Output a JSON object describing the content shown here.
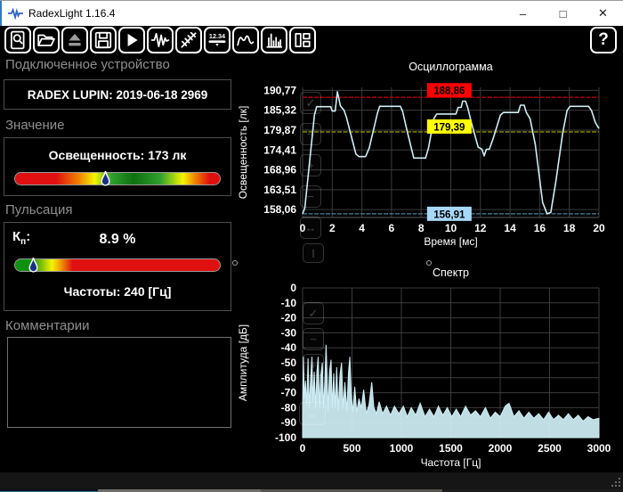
{
  "window": {
    "title": "RadexLight 1.16.4",
    "controls": {
      "minimize": "–",
      "maximize": "□",
      "close": "✕"
    }
  },
  "toolbar": {
    "buttons": [
      {
        "name": "preview",
        "icon": "magnifier"
      },
      {
        "name": "open",
        "icon": "folder"
      },
      {
        "name": "eject",
        "icon": "eject"
      },
      {
        "name": "save",
        "icon": "floppy"
      },
      {
        "name": "start",
        "icon": "play"
      },
      {
        "name": "pulsation-mode",
        "icon": "pulse"
      },
      {
        "name": "light-rays-mode",
        "icon": "rays"
      },
      {
        "name": "numeric-display",
        "icon": "numeric",
        "label": "12.34"
      },
      {
        "name": "oscillogram-view",
        "icon": "wave"
      },
      {
        "name": "spectrum-view",
        "icon": "bars"
      },
      {
        "name": "layout-view",
        "icon": "layout"
      }
    ],
    "help_label": "?"
  },
  "sections": {
    "device": {
      "header": "Подключенное устройство",
      "device_name": "RADEX LUPIN: 2019-06-18 2969"
    },
    "value": {
      "header": "Значение",
      "value_label": "Освещенность: 173 лк",
      "bar_marker": 0.44
    },
    "pulsation": {
      "header": "Пульсация",
      "kp_prefix": "К",
      "kp_sub": "п",
      "kp_suffix": ":",
      "value": "8.9 %",
      "bar_marker": 0.085,
      "freq_label": "Частоты: 240 [Гц]"
    },
    "comments": {
      "header": "Комментарии",
      "text": ""
    }
  },
  "colors": {
    "waveform": "#cfeef5",
    "ref_max_line": "#b40000",
    "ref_max_bg": "#ff0000",
    "ref_avg_line": "#8f8f00",
    "ref_avg_bg": "#ffff00",
    "ref_min_line": "#4e82a0",
    "ref_min_bg": "#a8d8f8",
    "grid": "#3c3c3c"
  },
  "chart_data": [
    {
      "type": "line",
      "title": "Осциллограмма",
      "xlabel": "Время [мс]",
      "ylabel": "Освещенность [лк]",
      "xlim": [
        0,
        20
      ],
      "ylim": [
        155.9,
        191.6
      ],
      "xticks": [
        0,
        2,
        4,
        6,
        8,
        10,
        12,
        14,
        16,
        18,
        20
      ],
      "xtick_labels": [
        "0",
        "2",
        "4",
        "6",
        "8",
        "10",
        "12",
        "14",
        "16",
        "18",
        "20"
      ],
      "yticks": [
        190.77,
        185.32,
        179.87,
        174.41,
        168.96,
        163.51,
        158.06
      ],
      "ytick_labels": [
        "190,77",
        "185,32",
        "179,87",
        "174,41",
        "168,96",
        "163,51",
        "158,06"
      ],
      "grid": true,
      "ref_lines": [
        {
          "value": 188.86,
          "label": "188,86",
          "line_color": "#b40000",
          "label_bg": "#ff0000",
          "label_dy": -16
        },
        {
          "value": 179.39,
          "label": "179,39",
          "line_color": "#8f8f00",
          "label_bg": "#ffff00",
          "label_dy": -14
        },
        {
          "value": 156.91,
          "label": "156,91",
          "line_color": "#4e82a0",
          "label_bg": "#a8d8f8",
          "label_dy": -8
        }
      ],
      "series": [
        {
          "name": "illuminance",
          "color": "#cfeef5",
          "points": [
            [
              0,
              156.9
            ],
            [
              0.15,
              158.5
            ],
            [
              0.8,
              184.0
            ],
            [
              0.95,
              186.3
            ],
            [
              1.9,
              186.3
            ],
            [
              2.0,
              185.1
            ],
            [
              2.2,
              185.1
            ],
            [
              2.35,
              190.4
            ],
            [
              2.55,
              186.5
            ],
            [
              2.8,
              185.3
            ],
            [
              2.95,
              183.5
            ],
            [
              3.6,
              173.3
            ],
            [
              3.8,
              172.6
            ],
            [
              4.25,
              172.6
            ],
            [
              4.5,
              175.0
            ],
            [
              5.05,
              184.5
            ],
            [
              5.2,
              186.4
            ],
            [
              6.6,
              186.4
            ],
            [
              6.75,
              185.0
            ],
            [
              7.0,
              180.5
            ],
            [
              7.5,
              172.2
            ],
            [
              8.3,
              172.2
            ],
            [
              8.5,
              175.0
            ],
            [
              8.85,
              183.0
            ],
            [
              9.05,
              184.3
            ],
            [
              10.35,
              184.3
            ],
            [
              10.5,
              186.1
            ],
            [
              10.7,
              186.1
            ],
            [
              10.8,
              187.8
            ],
            [
              11.0,
              187.8
            ],
            [
              11.15,
              186.0
            ],
            [
              11.35,
              182.5
            ],
            [
              11.85,
              175.2
            ],
            [
              12.1,
              174.6
            ],
            [
              12.25,
              172.8
            ],
            [
              12.4,
              174.6
            ],
            [
              12.6,
              174.6
            ],
            [
              12.85,
              177.5
            ],
            [
              13.35,
              184.0
            ],
            [
              13.55,
              184.7
            ],
            [
              14.55,
              184.7
            ],
            [
              14.7,
              186.7
            ],
            [
              14.95,
              186.7
            ],
            [
              15.1,
              184.7
            ],
            [
              15.35,
              183.0
            ],
            [
              15.7,
              176.0
            ],
            [
              16.2,
              160.0
            ],
            [
              16.5,
              156.9
            ],
            [
              16.75,
              157.3
            ],
            [
              17.1,
              166.0
            ],
            [
              17.55,
              179.0
            ],
            [
              17.85,
              185.3
            ],
            [
              18.05,
              186.4
            ],
            [
              19.3,
              186.4
            ],
            [
              19.5,
              185.2
            ],
            [
              19.75,
              182.0
            ],
            [
              20,
              180.3
            ]
          ]
        }
      ]
    },
    {
      "type": "area",
      "title": "Спектр",
      "xlabel": "Частота [Гц]",
      "ylabel": "Амплитуда [дБ]",
      "xlim": [
        0,
        3000
      ],
      "ylim": [
        -100,
        0
      ],
      "xticks": [
        0,
        500,
        1000,
        1500,
        2000,
        2500,
        3000
      ],
      "xtick_labels": [
        "0",
        "500",
        "1000",
        "1500",
        "2000",
        "2500",
        "3000"
      ],
      "yticks": [
        0,
        -10,
        -20,
        -30,
        -40,
        -50,
        -60,
        -70,
        -80,
        -90,
        -100
      ],
      "ytick_labels": [
        "0",
        "-10",
        "-20",
        "-30",
        "-40",
        "-50",
        "-60",
        "-70",
        "-80",
        "-90",
        "-100"
      ],
      "grid": true,
      "series": [
        {
          "name": "spectrum",
          "color": "#cfeef5",
          "points": [
            [
              0,
              -79
            ],
            [
              8,
              -46
            ],
            [
              18,
              -74
            ],
            [
              30,
              -62
            ],
            [
              42,
              -79
            ],
            [
              55,
              -47
            ],
            [
              68,
              -80
            ],
            [
              80,
              -62
            ],
            [
              95,
              -46
            ],
            [
              105,
              -76
            ],
            [
              118,
              -56
            ],
            [
              132,
              -80
            ],
            [
              145,
              -56
            ],
            [
              158,
              -46
            ],
            [
              172,
              -80
            ],
            [
              185,
              -58
            ],
            [
              200,
              -50
            ],
            [
              212,
              -80
            ],
            [
              225,
              -62
            ],
            [
              238,
              -38
            ],
            [
              248,
              -58
            ],
            [
              258,
              -82
            ],
            [
              272,
              -56
            ],
            [
              288,
              -48
            ],
            [
              300,
              -80
            ],
            [
              315,
              -57
            ],
            [
              330,
              -80
            ],
            [
              345,
              -53
            ],
            [
              360,
              -82
            ],
            [
              378,
              -58
            ],
            [
              395,
              -50
            ],
            [
              410,
              -80
            ],
            [
              428,
              -63
            ],
            [
              448,
              -82
            ],
            [
              465,
              -56
            ],
            [
              478,
              -46
            ],
            [
              492,
              -70
            ],
            [
              508,
              -83
            ],
            [
              528,
              -66
            ],
            [
              548,
              -83
            ],
            [
              570,
              -74
            ],
            [
              595,
              -80
            ],
            [
              618,
              -68
            ],
            [
              645,
              -84
            ],
            [
              672,
              -78
            ],
            [
              700,
              -63
            ],
            [
              722,
              -80
            ],
            [
              748,
              -84
            ],
            [
              775,
              -76
            ],
            [
              810,
              -84
            ],
            [
              850,
              -79
            ],
            [
              890,
              -85
            ],
            [
              930,
              -79
            ],
            [
              975,
              -84
            ],
            [
              1020,
              -79
            ],
            [
              1060,
              -86
            ],
            [
              1100,
              -80
            ],
            [
              1145,
              -85
            ],
            [
              1190,
              -77
            ],
            [
              1240,
              -86
            ],
            [
              1285,
              -81
            ],
            [
              1330,
              -86
            ],
            [
              1375,
              -79
            ],
            [
              1420,
              -85
            ],
            [
              1465,
              -80
            ],
            [
              1510,
              -86
            ],
            [
              1555,
              -81
            ],
            [
              1600,
              -86
            ],
            [
              1650,
              -79
            ],
            [
              1700,
              -85
            ],
            [
              1750,
              -82
            ],
            [
              1800,
              -86
            ],
            [
              1850,
              -80
            ],
            [
              1900,
              -87
            ],
            [
              1950,
              -83
            ],
            [
              2000,
              -86
            ],
            [
              2050,
              -79
            ],
            [
              2090,
              -77
            ],
            [
              2140,
              -86
            ],
            [
              2190,
              -82
            ],
            [
              2240,
              -87
            ],
            [
              2290,
              -83
            ],
            [
              2340,
              -87
            ],
            [
              2390,
              -84
            ],
            [
              2440,
              -88
            ],
            [
              2490,
              -83
            ],
            [
              2540,
              -88
            ],
            [
              2590,
              -85
            ],
            [
              2640,
              -88
            ],
            [
              2690,
              -84
            ],
            [
              2740,
              -88
            ],
            [
              2790,
              -85
            ],
            [
              2840,
              -89
            ],
            [
              2890,
              -86
            ],
            [
              2940,
              -88
            ],
            [
              3000,
              -87
            ]
          ]
        }
      ]
    }
  ]
}
